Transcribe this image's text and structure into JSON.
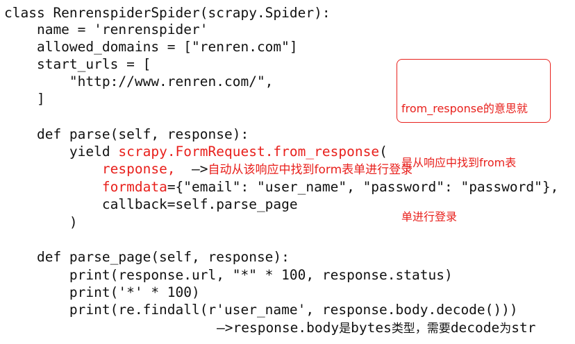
{
  "code": {
    "line1": "class RenrenspiderSpider(scrapy.Spider):",
    "line2": "    name = 'renrenspider'",
    "line3": "    allowed_domains = [\"renren.com\"]",
    "line4": "    start_urls = [",
    "line5": "        \"http://www.renren.com/\",",
    "line6": "    ]",
    "line8": "    def parse(self, response):",
    "line9_prefix": "        yield ",
    "line9_call": "scrapy.FormRequest.from_response",
    "line9_suffix": "(",
    "line10_indent": "            ",
    "line10_arg": "response,",
    "line10_arrow": "  —>",
    "line10_note": "自动从该响应中找到form表单进行登录",
    "line11_indent": "            ",
    "line11_kw": "formdata",
    "line11_rest": "={\"email\": \"user_name\", \"password\": \"password\"},",
    "line12": "            callback=self.parse_page",
    "line13": "        )",
    "line15": "    def parse_page(self, response):",
    "line16": "        print(response.url, \"*\" * 100, response.status)",
    "line17": "        print('*' * 100)",
    "line18": "        print(re.findall(r'user_name', response.body.decode()))",
    "line19_arrow": "—>",
    "line19_a": "response.body",
    "line19_b": "是",
    "line19_c": "bytes",
    "line19_d": "类型，需要",
    "line19_e": "decode",
    "line19_f": "为",
    "line19_g": "str"
  },
  "note": {
    "line1": "from_response的意思就",
    "line2": "是从响应中找到from表",
    "line3": "单进行登录"
  },
  "colors": {
    "highlight": "#e8201c",
    "text": "#111111",
    "background": "#ffffff"
  }
}
